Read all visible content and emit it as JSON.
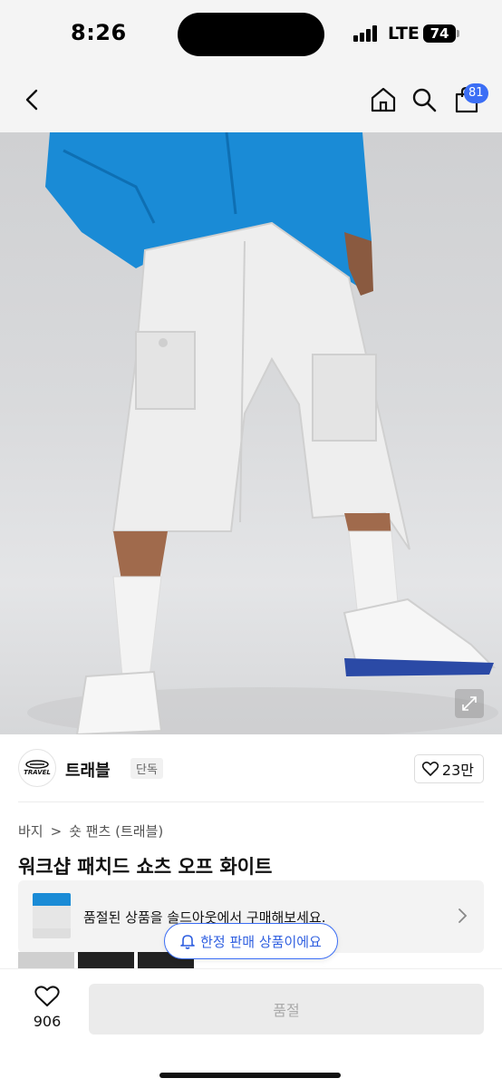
{
  "status_bar": {
    "time": "8:26",
    "network": "LTE",
    "battery": "74"
  },
  "nav": {
    "cart_count": "81"
  },
  "brand": {
    "logo_text": "TRAVEL",
    "name": "트래블",
    "tag": "단독",
    "likes": "23만"
  },
  "breadcrumb": {
    "category": "바지",
    "separator": ">",
    "subcategory": "숏 팬츠 (트래블)"
  },
  "product": {
    "title": "워크샵 패치드 쇼츠 오프 화이트"
  },
  "soldout_banner": {
    "text": "품절된 상품을 솔드아웃에서 구매해보세요."
  },
  "limited_notice": {
    "text": "한정 판매 상품이에요"
  },
  "bottom_bar": {
    "wish_count": "906",
    "cta_label": "품절"
  },
  "colors": {
    "accent": "#3b6ef5",
    "jacket": "#1a8bd6"
  }
}
